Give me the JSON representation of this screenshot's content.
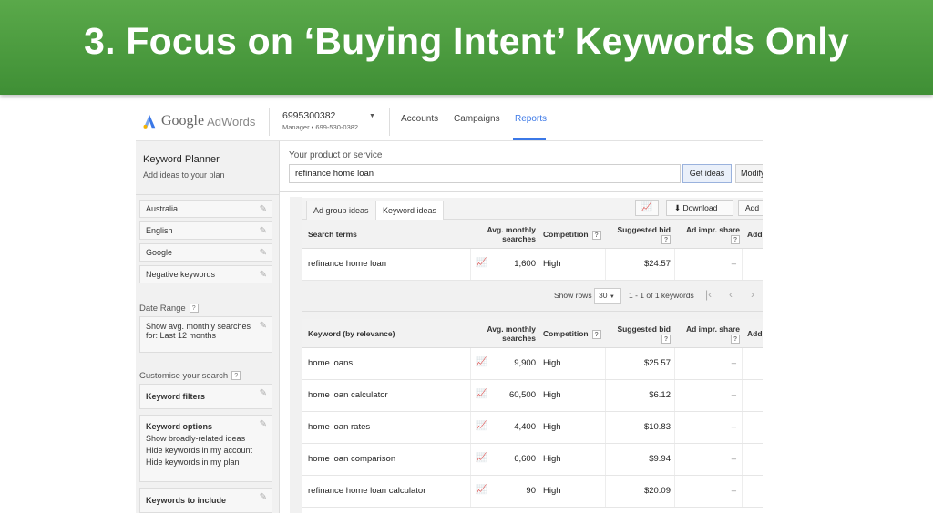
{
  "slide": {
    "title": "3. Focus on ‘Buying Intent’ Keywords Only"
  },
  "header": {
    "logo_google": "Google",
    "logo_adwords": "AdWords",
    "account_id": "6995300382",
    "account_sub": "Manager • 699-530-0382",
    "nav": [
      "Accounts",
      "Campaigns",
      "Reports"
    ],
    "active_nav": "Reports"
  },
  "sidebar": {
    "title": "Keyword Planner",
    "subtitle": "Add ideas to your plan",
    "targeting": [
      "Australia",
      "English",
      "Google",
      "Negative keywords"
    ],
    "date_range_label": "Date Range",
    "date_range_text_1": "Show avg. monthly searches",
    "date_range_text_2": "for: Last 12 months",
    "customise_label": "Customise your search",
    "keyword_filters": "Keyword filters",
    "keyword_options_title": "Keyword options",
    "keyword_options": [
      "Show broadly-related ideas",
      "Hide keywords in my account",
      "Hide keywords in my plan"
    ],
    "keywords_to_include": "Keywords to include"
  },
  "search": {
    "label": "Your product or service",
    "value": "refinance home loan",
    "get_ideas": "Get ideas",
    "modify": "Modify"
  },
  "tabs": [
    "Ad group ideas",
    "Keyword ideas"
  ],
  "active_tab": "Keyword ideas",
  "toolbar": {
    "download": "Download",
    "add": "Add"
  },
  "help_glyph": "?",
  "search_terms_table": {
    "headers": {
      "term": "Search terms",
      "searches_1": "Avg. monthly",
      "searches_2": "searches",
      "competition": "Competition",
      "bid": "Suggested bid",
      "impr": "Ad impr. share",
      "add": "Add"
    },
    "rows": [
      {
        "keyword": "refinance home loan",
        "searches": "1,600",
        "competition": "High",
        "bid": "$24.57",
        "impr": "–"
      }
    ]
  },
  "pager": {
    "label": "Show rows",
    "rows": "30",
    "range": "1 - 1 of 1 keywords"
  },
  "keyword_table": {
    "headers": {
      "term": "Keyword (by relevance)",
      "searches_1": "Avg. monthly",
      "searches_2": "searches",
      "competition": "Competition",
      "bid": "Suggested bid",
      "impr": "Ad impr. share",
      "add": "Add"
    },
    "rows": [
      {
        "keyword": "home loans",
        "searches": "9,900",
        "competition": "High",
        "bid": "$25.57",
        "impr": "–"
      },
      {
        "keyword": "home loan calculator",
        "searches": "60,500",
        "competition": "High",
        "bid": "$6.12",
        "impr": "–"
      },
      {
        "keyword": "home loan rates",
        "searches": "4,400",
        "competition": "High",
        "bid": "$10.83",
        "impr": "–"
      },
      {
        "keyword": "home loan comparison",
        "searches": "6,600",
        "competition": "High",
        "bid": "$9.94",
        "impr": "–"
      },
      {
        "keyword": "refinance home loan calculator",
        "searches": "90",
        "competition": "High",
        "bid": "$20.09",
        "impr": "–"
      }
    ]
  },
  "colors": {
    "banner_green": "#4c9e3f",
    "link_blue": "#3b78e7"
  }
}
